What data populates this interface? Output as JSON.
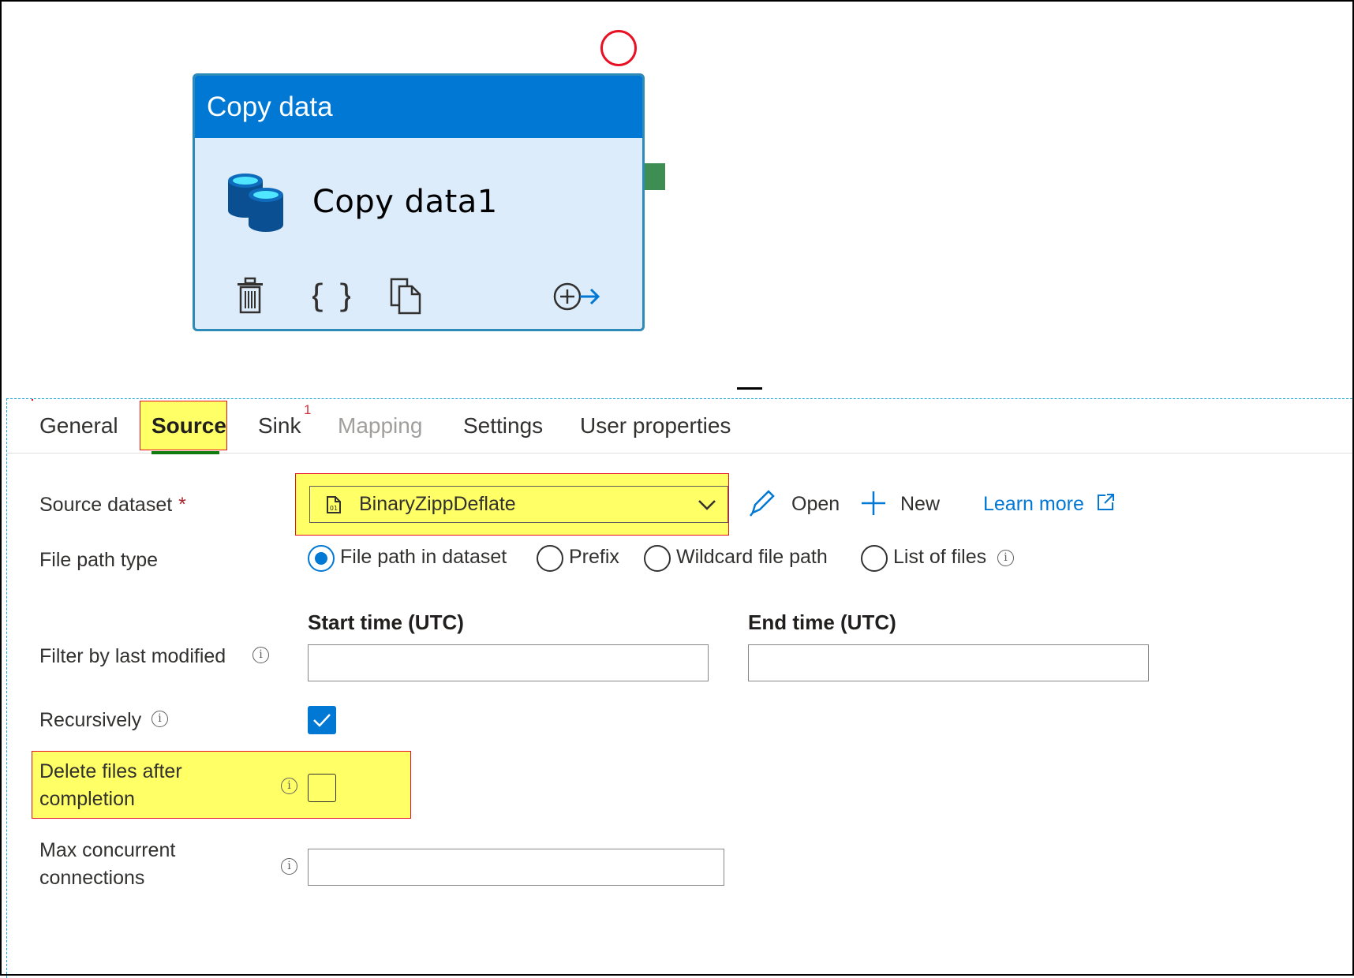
{
  "activity": {
    "header_title": "Copy data",
    "name": "Copy data1",
    "actions": [
      "delete-icon",
      "code-icon",
      "clone-icon",
      "add-output-icon"
    ]
  },
  "tabs": [
    {
      "label": "General"
    },
    {
      "label": "Source"
    },
    {
      "label": "Sink"
    },
    {
      "label": "Mapping"
    },
    {
      "label": "Settings"
    },
    {
      "label": "User properties"
    }
  ],
  "sink_badge": "1",
  "source": {
    "dataset_label": "Source dataset",
    "required_marker": "*",
    "dataset_value": "BinaryZippDeflate",
    "open_label": "Open",
    "new_label": "New",
    "learn_more_label": "Learn more",
    "file_path_type_label": "File path type",
    "file_path_options": [
      "File path in dataset",
      "Prefix",
      "Wildcard file path",
      "List of files"
    ],
    "file_path_selected": "File path in dataset",
    "filter_label": "Filter by last modified",
    "start_time_label": "Start time (UTC)",
    "end_time_label": "End time (UTC)",
    "start_time_value": "",
    "end_time_value": "",
    "recursively_label": "Recursively",
    "recursively_checked": true,
    "delete_files_label_line1": "Delete files after",
    "delete_files_label_line2": "completion",
    "delete_files_checked": false,
    "max_conn_label_line1": "Max concurrent",
    "max_conn_label_line2": "connections",
    "max_conn_value": ""
  },
  "colors": {
    "accent": "#0078d4",
    "card_header": "#0078d4",
    "card_body": "#dcecfb",
    "highlight": "#ffff66",
    "highlight_border": "#e81123",
    "success_port": "#3e8e54",
    "active_tab_underline": "#107c10",
    "link": "#0078d4"
  }
}
